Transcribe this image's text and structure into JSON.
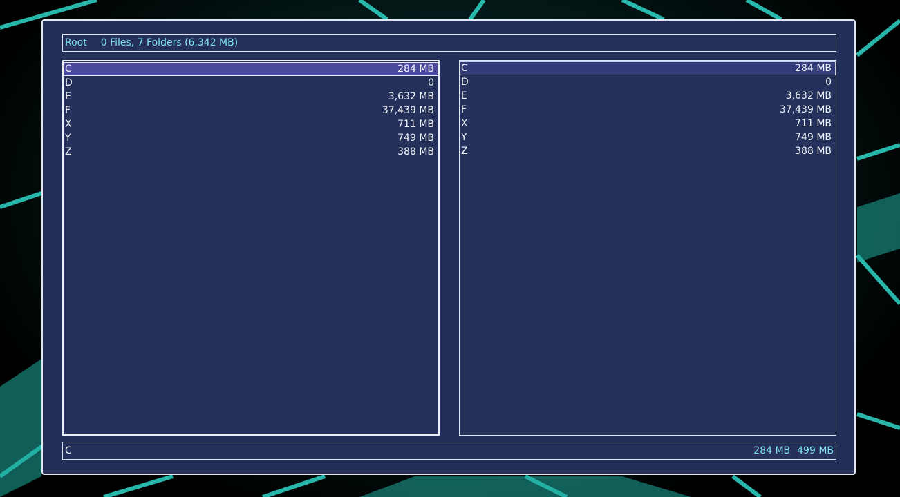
{
  "header": {
    "location": "Root",
    "summary": "0 Files, 7 Folders (6,342 MB)"
  },
  "left_pane": {
    "items": [
      {
        "name": "C",
        "size": "284 MB",
        "selected": true
      },
      {
        "name": "D",
        "size": "0",
        "selected": false
      },
      {
        "name": "E",
        "size": "3,632 MB",
        "selected": false
      },
      {
        "name": "F",
        "size": "37,439 MB",
        "selected": false
      },
      {
        "name": "X",
        "size": "711 MB",
        "selected": false
      },
      {
        "name": "Y",
        "size": "749 MB",
        "selected": false
      },
      {
        "name": "Z",
        "size": "388 MB",
        "selected": false
      }
    ]
  },
  "right_pane": {
    "items": [
      {
        "name": "C",
        "size": "284 MB",
        "selected": true
      },
      {
        "name": "D",
        "size": "0",
        "selected": false
      },
      {
        "name": "E",
        "size": "3,632 MB",
        "selected": false
      },
      {
        "name": "F",
        "size": "37,439 MB",
        "selected": false
      },
      {
        "name": "X",
        "size": "711 MB",
        "selected": false
      },
      {
        "name": "Y",
        "size": "749 MB",
        "selected": false
      },
      {
        "name": "Z",
        "size": "388 MB",
        "selected": false
      }
    ]
  },
  "status": {
    "current_item": "C",
    "used": "284 MB",
    "free": "499 MB"
  },
  "colors": {
    "panel_bg": "#25315a",
    "accent_text": "#7fe3f0",
    "selection_left": "#4b4a9c",
    "selection_right": "#333b78",
    "border": "#dfe6ee"
  }
}
